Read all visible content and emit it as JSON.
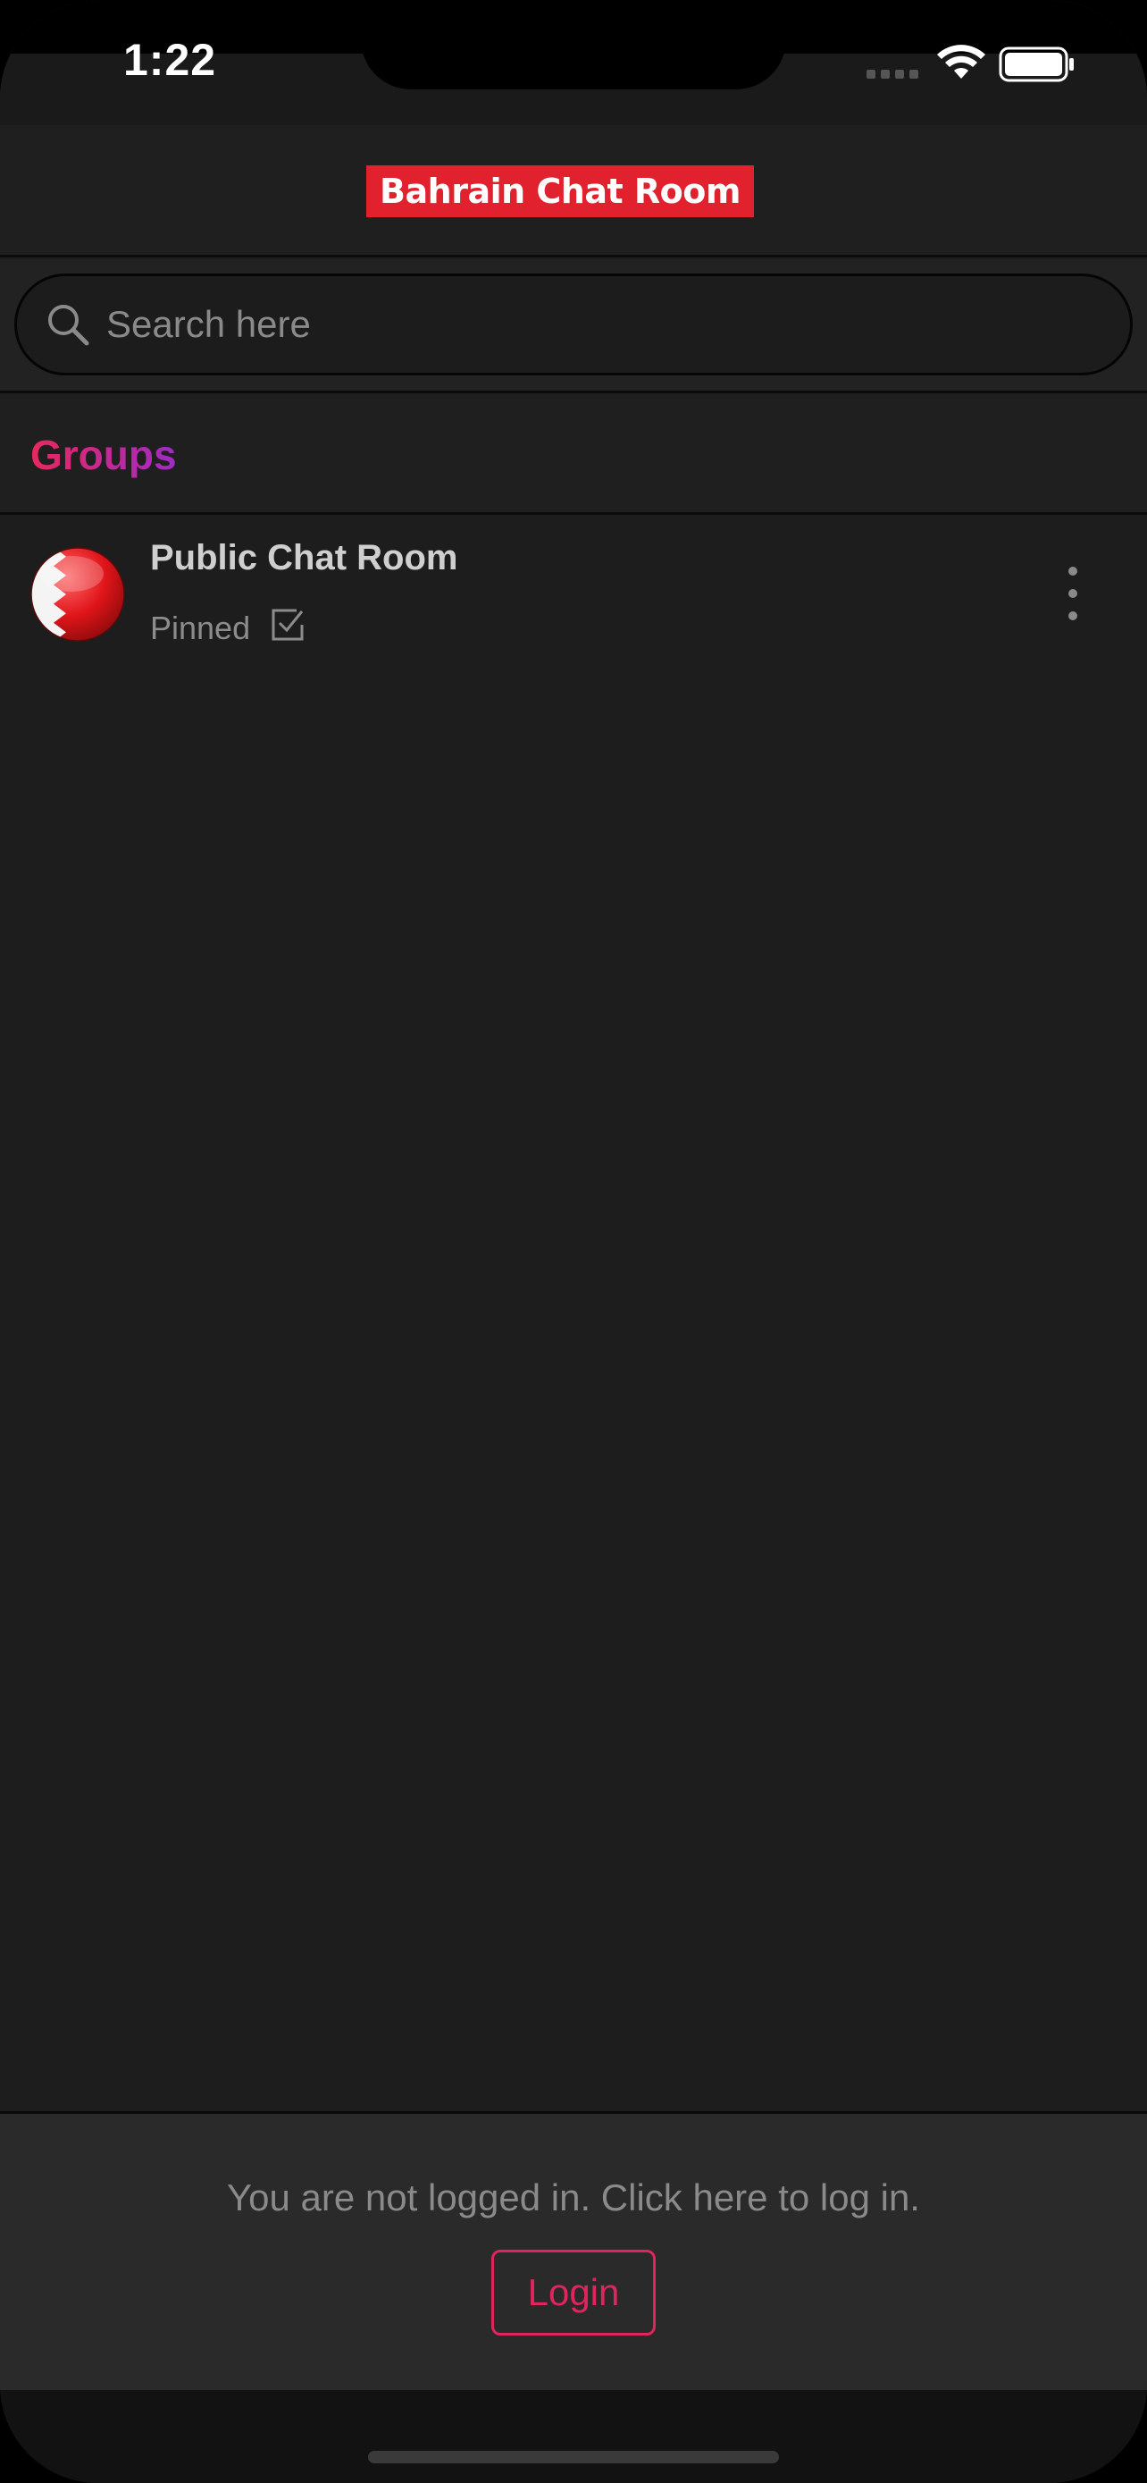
{
  "status": {
    "time": "1:22"
  },
  "header": {
    "title": "Bahrain Chat Room"
  },
  "search": {
    "placeholder": "Search here"
  },
  "groups": {
    "title": "Groups"
  },
  "list": {
    "items": [
      {
        "title": "Public Chat Room",
        "subtitle": "Pinned",
        "avatar_icon": "bahrain-flag-icon"
      }
    ]
  },
  "footer": {
    "message": "You are not logged in. Click here to log in.",
    "login_label": "Login"
  },
  "colors": {
    "brand_red": "#e2212f",
    "accent_pink": "#e0245e",
    "accent_purple": "#a02ac7",
    "background": "#1d1d1d"
  }
}
